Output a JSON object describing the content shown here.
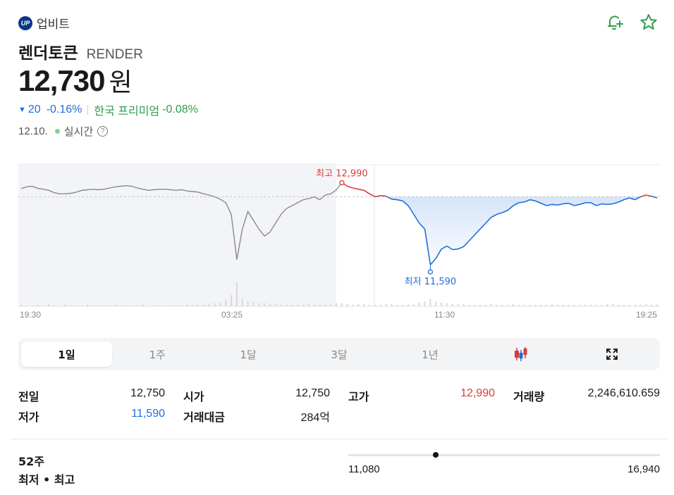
{
  "exchange": {
    "logo_text": "UP",
    "name": "업비트"
  },
  "coin": {
    "name": "렌더토큰",
    "symbol": "RENDER"
  },
  "price": {
    "value": "12,730",
    "unit": "원"
  },
  "change": {
    "arrow": "▼",
    "amount": "20",
    "percent": "-0.16%",
    "premium_label": "한국 프리미엄",
    "premium_value": "-0.08%"
  },
  "time": {
    "date": "12.10.",
    "live_label": "실시간",
    "help": "?"
  },
  "chart_data": {
    "type": "line",
    "x_ticks": [
      "19:30",
      "03:25",
      "11:30",
      "19:25"
    ],
    "reference_price": 12750,
    "high": {
      "label": "최고 12,990",
      "value": 12990
    },
    "low": {
      "label": "최저 11,590",
      "value": 11590
    },
    "series": [
      {
        "values": [
          12890,
          12920,
          12930,
          12895,
          12880,
          12860,
          12820,
          12800,
          12800,
          12810,
          12830,
          12860,
          12870,
          12880,
          12870,
          12880,
          12900,
          12920,
          12930,
          12940,
          12930,
          12900,
          12880,
          12860,
          12870,
          12880,
          12880,
          12870,
          12860,
          12870,
          12850,
          12840,
          12830,
          12800,
          12780,
          12750,
          12710,
          12650,
          12450,
          11680,
          12200,
          12500,
          12350,
          12200,
          12080,
          12150,
          12300,
          12450,
          12550,
          12600,
          12650,
          12700,
          12720,
          12750,
          12700,
          12780,
          12800,
          12870,
          12990,
          12930,
          12900,
          12880,
          12860,
          12800,
          12750,
          12770,
          12760,
          12710,
          12700,
          12680,
          12600,
          12450,
          12300,
          12200,
          11590,
          11700,
          11860,
          11910,
          11850,
          11860,
          11900,
          12000,
          12100,
          12200,
          12300,
          12400,
          12450,
          12480,
          12520,
          12600,
          12650,
          12660,
          12700,
          12680,
          12640,
          12600,
          12620,
          12610,
          12630,
          12640,
          12600,
          12620,
          12650,
          12650,
          12600,
          12630,
          12620,
          12630,
          12660,
          12700,
          12730,
          12700,
          12750,
          12780,
          12760,
          12730
        ]
      }
    ],
    "volume": [
      2,
      1,
      1,
      2,
      1,
      3,
      1,
      1,
      2,
      1,
      1,
      1,
      2,
      1,
      1,
      1,
      1,
      2,
      1,
      1,
      1,
      1,
      2,
      1,
      1,
      1,
      1,
      1,
      1,
      1,
      2,
      1,
      2,
      2,
      3,
      4,
      5,
      8,
      14,
      30,
      10,
      7,
      5,
      4,
      4,
      3,
      3,
      2,
      3,
      2,
      2,
      2,
      3,
      3,
      2,
      2,
      3,
      4,
      4,
      3,
      2,
      3,
      3,
      2,
      2,
      2,
      3,
      3,
      2,
      2,
      2,
      3,
      5,
      6,
      9,
      6,
      5,
      4,
      3,
      3,
      3,
      2,
      2,
      2,
      2,
      3,
      2,
      2,
      2,
      3,
      2,
      2,
      2,
      2,
      2,
      2,
      3,
      2,
      2,
      2,
      2,
      2,
      2,
      2,
      2,
      2,
      3,
      3,
      2,
      2,
      2,
      2,
      2,
      3,
      2,
      2
    ]
  },
  "periods": [
    {
      "label": "1일",
      "active": true
    },
    {
      "label": "1주"
    },
    {
      "label": "1달"
    },
    {
      "label": "3달"
    },
    {
      "label": "1년"
    }
  ],
  "icons": {
    "alert": "bell-plus-icon",
    "favorite": "star-icon",
    "candle": "candlestick-icon",
    "expand": "expand-icon"
  },
  "colors": {
    "up": "#d93b3b",
    "down": "#1e6fd9",
    "accent_green": "#2e9e4b",
    "past_shade": "#f3f4f8"
  },
  "stats": {
    "prev_close": {
      "label": "전일",
      "value": "12,750"
    },
    "low": {
      "label": "저가",
      "value": "11,590"
    },
    "open": {
      "label": "시가",
      "value": "12,750"
    },
    "trade_amount": {
      "label": "거래대금",
      "value": "284",
      "unit": "억"
    },
    "high": {
      "label": "고가",
      "value": "12,990"
    },
    "volume": {
      "label": "거래량",
      "value": "2,246,610.659"
    }
  },
  "week52": {
    "line1": "52주",
    "line2": "최저 • 최고",
    "low": "11,080",
    "high": "16,940",
    "current_position": 0.2816
  }
}
